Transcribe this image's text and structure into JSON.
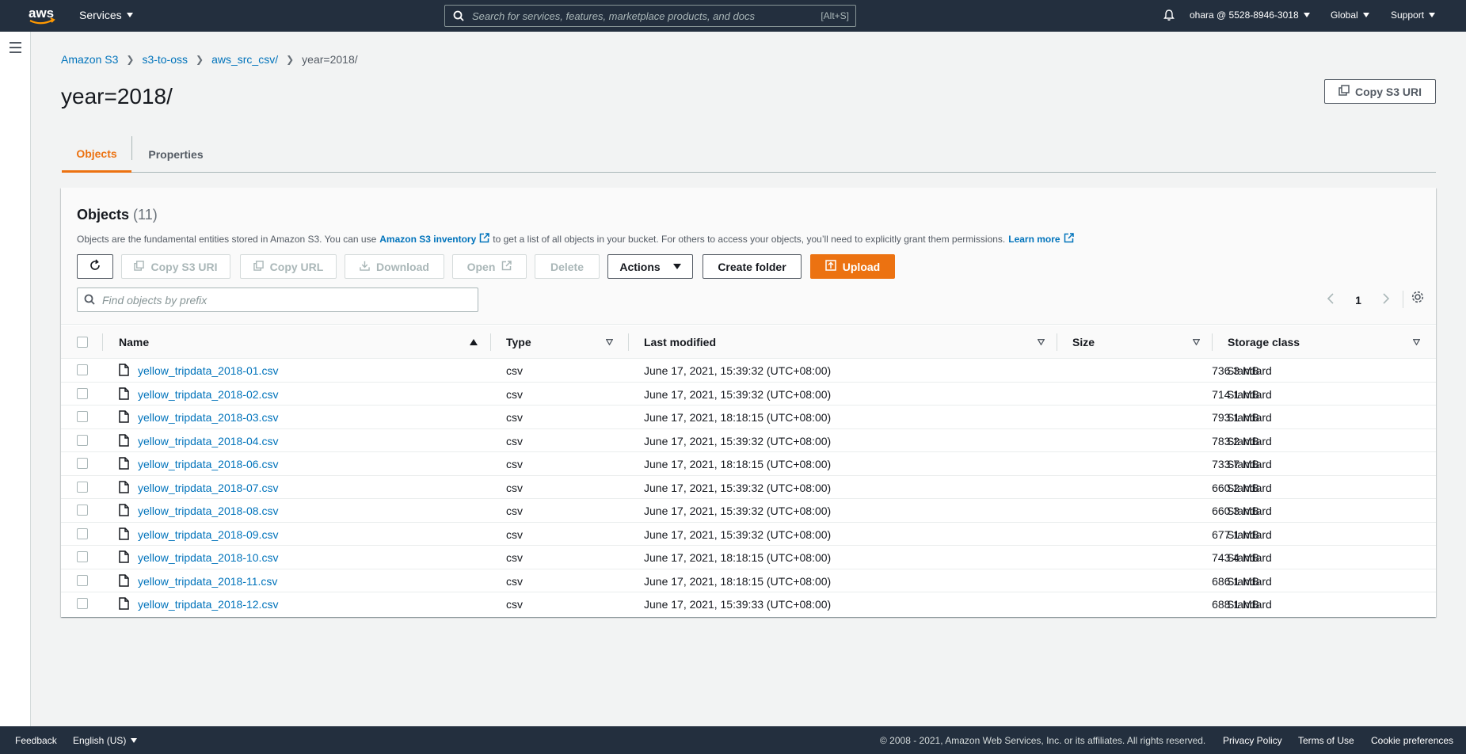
{
  "nav": {
    "services_label": "Services",
    "search_placeholder": "Search for services, features, marketplace products, and docs",
    "search_shortcut": "[Alt+S]",
    "account_label": "ohara @ 5528-8946-3018",
    "region_label": "Global",
    "support_label": "Support"
  },
  "breadcrumbs": [
    "Amazon S3",
    "s3-to-oss",
    "aws_src_csv/",
    "year=2018/"
  ],
  "page": {
    "title": "year=2018/",
    "copy_uri_label": "Copy S3 URI"
  },
  "tabs": [
    "Objects",
    "Properties"
  ],
  "objects_panel": {
    "title": "Objects",
    "count": "(11)",
    "desc_before": "Objects are the fundamental entities stored in Amazon S3. You can use",
    "desc_link1": "Amazon S3 inventory",
    "desc_after": "to get a list of all objects in your bucket. For others to access your objects, you’ll need to explicitly grant them permissions.",
    "desc_link2": "Learn more",
    "buttons": {
      "copy_uri": "Copy S3 URI",
      "copy_url": "Copy URL",
      "download": "Download",
      "open": "Open",
      "delete": "Delete",
      "actions": "Actions",
      "create_folder": "Create folder",
      "upload": "Upload"
    },
    "find_placeholder": "Find objects by prefix",
    "page_number": "1"
  },
  "table": {
    "columns": [
      "Name",
      "Type",
      "Last modified",
      "Size",
      "Storage class"
    ],
    "rows": [
      {
        "name": "yellow_tripdata_2018-01.csv",
        "type": "csv",
        "modified": "June 17, 2021, 15:39:32 (UTC+08:00)",
        "size": "736.3 MB",
        "class": "Standard"
      },
      {
        "name": "yellow_tripdata_2018-02.csv",
        "type": "csv",
        "modified": "June 17, 2021, 15:39:32 (UTC+08:00)",
        "size": "714.1 MB",
        "class": "Standard"
      },
      {
        "name": "yellow_tripdata_2018-03.csv",
        "type": "csv",
        "modified": "June 17, 2021, 18:18:15 (UTC+08:00)",
        "size": "793.1 MB",
        "class": "Standard"
      },
      {
        "name": "yellow_tripdata_2018-04.csv",
        "type": "csv",
        "modified": "June 17, 2021, 15:39:32 (UTC+08:00)",
        "size": "783.2 MB",
        "class": "Standard"
      },
      {
        "name": "yellow_tripdata_2018-06.csv",
        "type": "csv",
        "modified": "June 17, 2021, 18:18:15 (UTC+08:00)",
        "size": "733.7 MB",
        "class": "Standard"
      },
      {
        "name": "yellow_tripdata_2018-07.csv",
        "type": "csv",
        "modified": "June 17, 2021, 15:39:32 (UTC+08:00)",
        "size": "660.2 MB",
        "class": "Standard"
      },
      {
        "name": "yellow_tripdata_2018-08.csv",
        "type": "csv",
        "modified": "June 17, 2021, 15:39:32 (UTC+08:00)",
        "size": "660.3 MB",
        "class": "Standard"
      },
      {
        "name": "yellow_tripdata_2018-09.csv",
        "type": "csv",
        "modified": "June 17, 2021, 15:39:32 (UTC+08:00)",
        "size": "677.1 MB",
        "class": "Standard"
      },
      {
        "name": "yellow_tripdata_2018-10.csv",
        "type": "csv",
        "modified": "June 17, 2021, 18:18:15 (UTC+08:00)",
        "size": "743.4 MB",
        "class": "Standard"
      },
      {
        "name": "yellow_tripdata_2018-11.csv",
        "type": "csv",
        "modified": "June 17, 2021, 18:18:15 (UTC+08:00)",
        "size": "686.1 MB",
        "class": "Standard"
      },
      {
        "name": "yellow_tripdata_2018-12.csv",
        "type": "csv",
        "modified": "June 17, 2021, 15:39:33 (UTC+08:00)",
        "size": "688.1 MB",
        "class": "Standard"
      }
    ]
  },
  "footer": {
    "feedback": "Feedback",
    "language": "English (US)",
    "copyright": "© 2008 - 2021, Amazon Web Services, Inc. or its affiliates. All rights reserved.",
    "privacy": "Privacy Policy",
    "terms": "Terms of Use",
    "cookies": "Cookie preferences"
  },
  "colors": {
    "nav_bg": "#232f3e",
    "accent": "#ec7211",
    "link": "#0073bb"
  }
}
